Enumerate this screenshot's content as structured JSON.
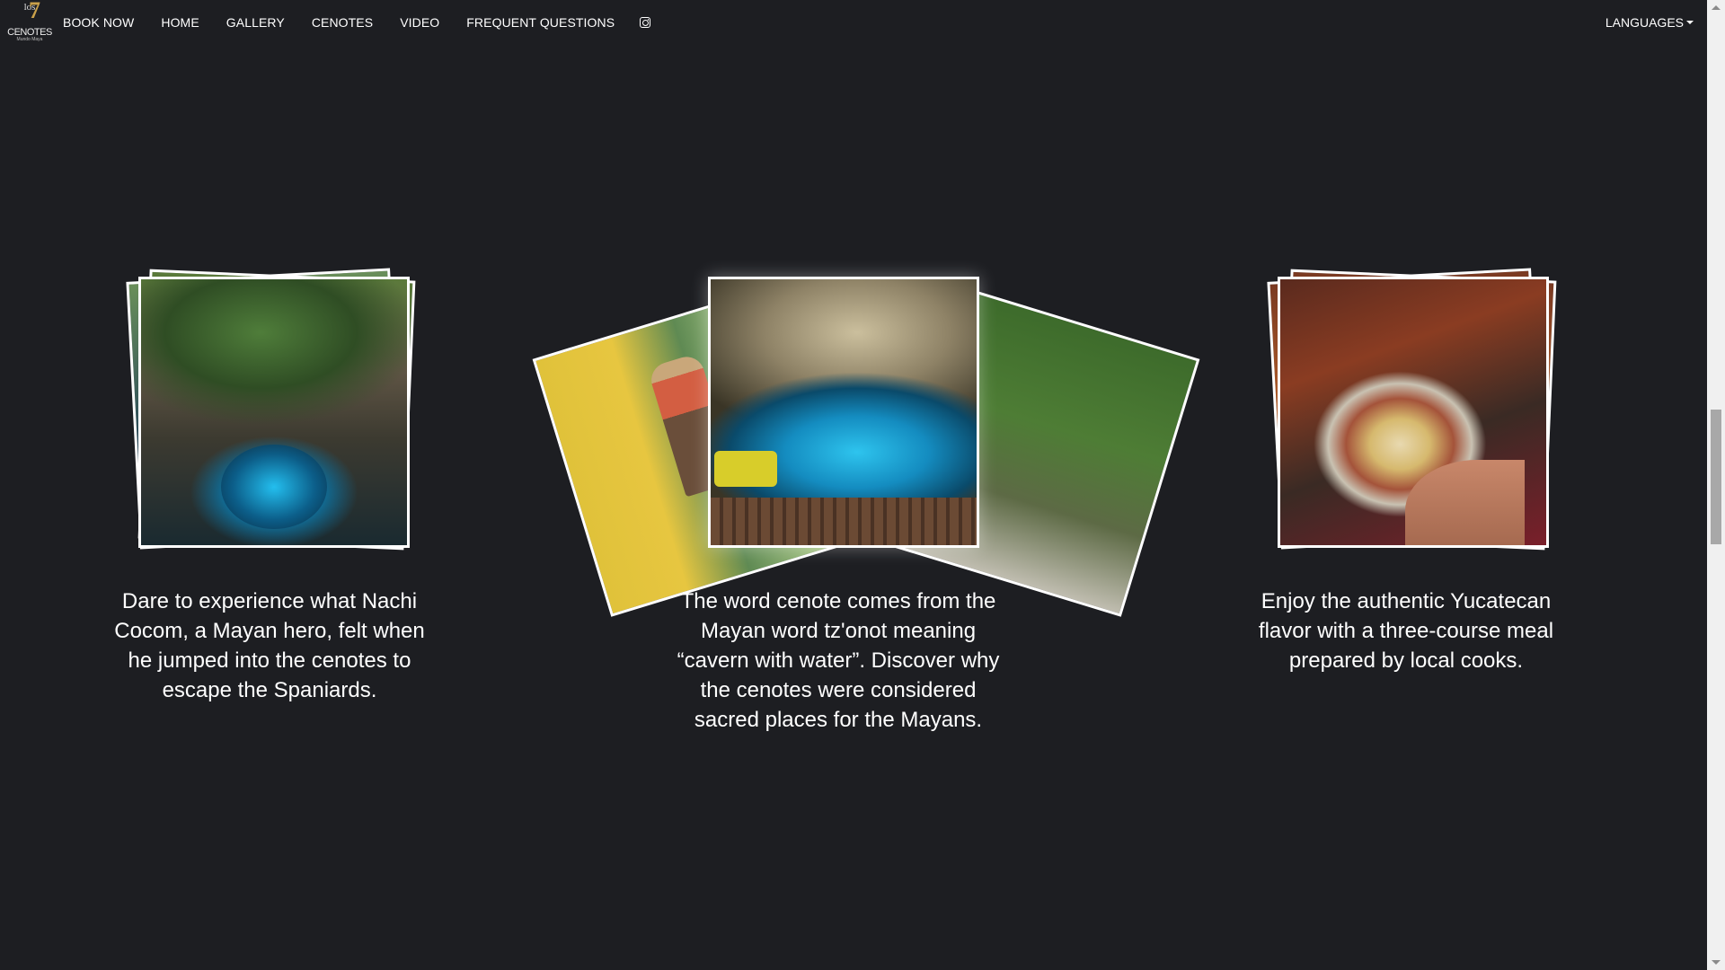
{
  "nav": {
    "logo": {
      "line1": "los",
      "number": "7",
      "line2": "CENOTES",
      "line3": "Mundo Maya"
    },
    "items": [
      {
        "label": "BOOK NOW"
      },
      {
        "label": "HOME"
      },
      {
        "label": "GALLERY"
      },
      {
        "label": "CENOTES"
      },
      {
        "label": "VIDEO"
      },
      {
        "label": "FREQUENT QUESTIONS"
      }
    ],
    "social_icon": "instagram-icon",
    "languages_label": "LANGUAGES",
    "languages_icon": "caret-down-icon"
  },
  "cards": [
    {
      "caption": "Dare to experience what Nachi Cocom, a Mayan hero, felt when he jumped into the cenotes to escape the Spaniards.",
      "photo": "cenote-jungle-photo"
    },
    {
      "caption": "The word cenote comes from the Mayan word tz'onot meaning “cavern with water”. Discover why the cenotes were considered sacred places for the Mayans.",
      "photo": "cave-cenote-photo"
    },
    {
      "caption": "Enjoy the authentic Yucatecan flavor with a three-course meal prepared by local cooks.",
      "photo": "yucatecan-meal-photo"
    }
  ],
  "colors": {
    "background": "#1d1e22",
    "text": "#ffffff",
    "photo_border": "#ffffff"
  }
}
